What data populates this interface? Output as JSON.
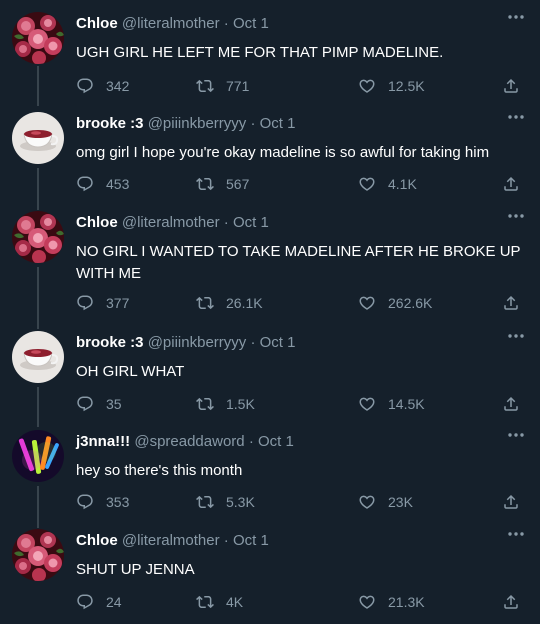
{
  "tweets": [
    {
      "name": "Chloe",
      "handle": "@literalmother",
      "dot": "·",
      "date": "Oct 1",
      "text": "UGH GIRL HE LEFT ME FOR THAT PIMP MADELINE.",
      "replies": "342",
      "retweets": "771",
      "likes": "12.5K",
      "avatar": "roses-avatar"
    },
    {
      "name": "brooke :3",
      "handle": "@piiinkberryyy",
      "dot": "·",
      "date": "Oct 1",
      "text": "omg girl I hope you're okay madeline is so awful for taking him",
      "replies": "453",
      "retweets": "567",
      "likes": "4.1K",
      "avatar": "cup-avatar"
    },
    {
      "name": "Chloe",
      "handle": "@literalmother",
      "dot": "·",
      "date": "Oct 1",
      "text": "NO GIRL I WANTED TO TAKE MADELINE AFTER HE BROKE UP WITH ME",
      "replies": "377",
      "retweets": "26.1K",
      "likes": "262.6K",
      "avatar": "roses-avatar"
    },
    {
      "name": "brooke :3",
      "handle": "@piiinkberryyy",
      "dot": "·",
      "date": "Oct 1",
      "text": "OH GIRL WHAT",
      "replies": "35",
      "retweets": "1.5K",
      "likes": "14.5K",
      "avatar": "cup-avatar"
    },
    {
      "name": "j3nna!!!",
      "handle": "@spreaddaword",
      "dot": "·",
      "date": "Oct 1",
      "text": "hey so there's this month",
      "replies": "353",
      "retweets": "5.3K",
      "likes": "23K",
      "avatar": "glowsticks-avatar"
    },
    {
      "name": "Chloe",
      "handle": "@literalmother",
      "dot": "·",
      "date": "Oct 1",
      "text": "SHUT UP JENNA",
      "replies": "24",
      "retweets": "4K",
      "likes": "21.3K",
      "avatar": "roses-avatar"
    }
  ],
  "colors": {
    "background": "#15202b",
    "secondary_text": "#8899a6",
    "thread_line": "#38444d"
  }
}
